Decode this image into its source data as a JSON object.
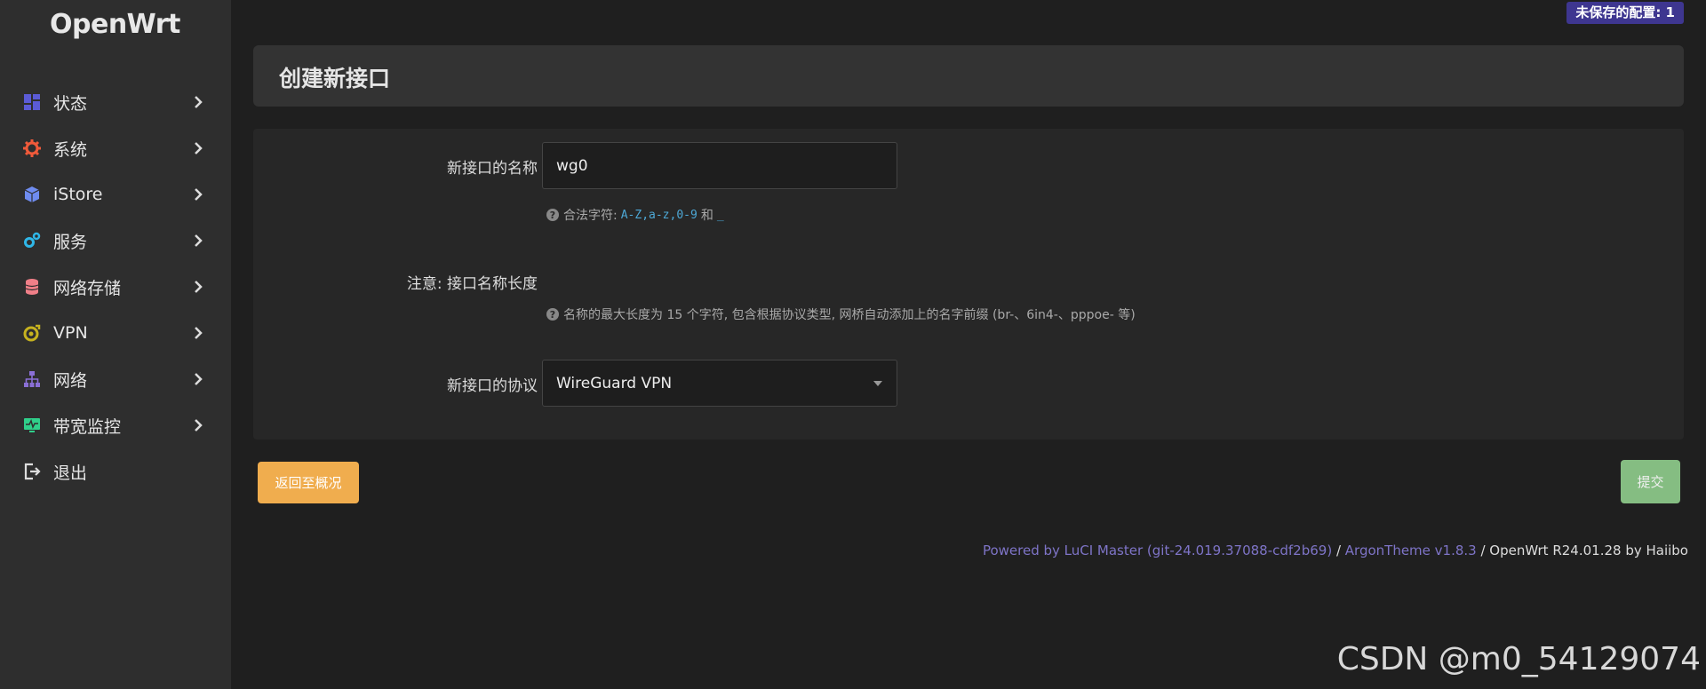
{
  "brand": {
    "logo": "OpenWrt"
  },
  "badge": {
    "unsaved": "未保存的配置: 1"
  },
  "sidebar": {
    "items": [
      {
        "label": "状态",
        "icon": "dashboard-icon",
        "color": "#5b5bd6"
      },
      {
        "label": "系统",
        "icon": "gear-icon",
        "color": "#f05a3a"
      },
      {
        "label": "iStore",
        "icon": "cube-icon",
        "color": "#6f8cf0"
      },
      {
        "label": "服务",
        "icon": "cogs-icon",
        "color": "#2fb7e8"
      },
      {
        "label": "网络存储",
        "icon": "database-icon",
        "color": "#f07f88"
      },
      {
        "label": "VPN",
        "icon": "vpn-icon",
        "color": "#c6b21f"
      },
      {
        "label": "网络",
        "icon": "sitemap-icon",
        "color": "#8a6fd6"
      },
      {
        "label": "带宽监控",
        "icon": "monitor-icon",
        "color": "#2fcf8a"
      },
      {
        "label": "退出",
        "icon": "logout-icon",
        "color": "#dddddd"
      }
    ]
  },
  "page": {
    "title": "创建新接口"
  },
  "form": {
    "name_label": "新接口的名称",
    "name_value": "wg0",
    "name_hint_prefix": "合法字符:",
    "name_hint_code1": "A-Z",
    "name_hint_code2": "a-z",
    "name_hint_code3": "0-9",
    "name_hint_and": "和",
    "name_hint_code4": "_",
    "note_label": "注意: 接口名称长度",
    "note_hint": "名称的最大长度为 15 个字符, 包含根据协议类型, 网桥自动添加上的名字前缀 (br-、6in4-、pppoe- 等)",
    "protocol_label": "新接口的协议",
    "protocol_value": "WireGuard VPN"
  },
  "buttons": {
    "back": "返回至概况",
    "submit": "提交"
  },
  "footer": {
    "luci": "Powered by LuCI Master (git-24.019.37088-cdf2b69)",
    "sep1": " / ",
    "theme": "ArgonTheme v1.8.3",
    "rest": " / OpenWrt R24.01.28 by Haiibo"
  },
  "watermark": "CSDN @m0_54129074"
}
